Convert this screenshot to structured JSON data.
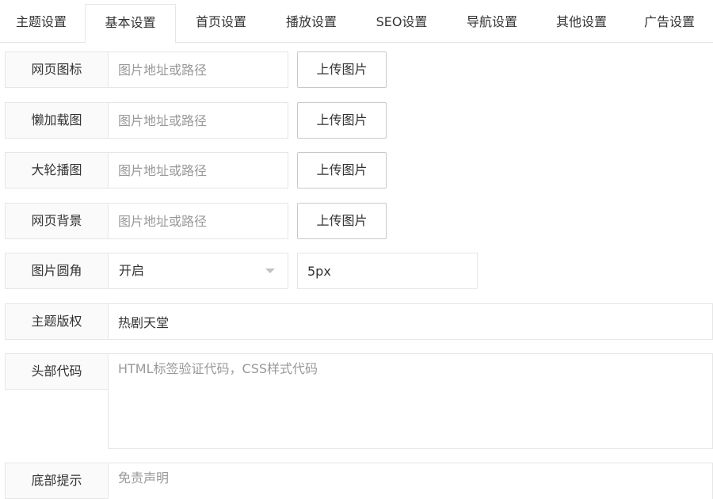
{
  "tabs": [
    {
      "label": "主题设置"
    },
    {
      "label": "基本设置"
    },
    {
      "label": "首页设置"
    },
    {
      "label": "播放设置"
    },
    {
      "label": "SEO设置"
    },
    {
      "label": "导航设置"
    },
    {
      "label": "其他设置"
    },
    {
      "label": "广告设置"
    }
  ],
  "active_tab": "基本设置",
  "form": {
    "favicon": {
      "label": "网页图标",
      "placeholder": "图片地址或路径",
      "button": "上传图片"
    },
    "lazyload": {
      "label": "懒加载图",
      "placeholder": "图片地址或路径",
      "button": "上传图片"
    },
    "carousel": {
      "label": "大轮播图",
      "placeholder": "图片地址或路径",
      "button": "上传图片"
    },
    "background": {
      "label": "网页背景",
      "placeholder": "图片地址或路径",
      "button": "上传图片"
    },
    "image_radius": {
      "label": "图片圆角",
      "select_value": "开启",
      "radius_value": "5px"
    },
    "copyright": {
      "label": "主题版权",
      "value": "热剧天堂"
    },
    "head_code": {
      "label": "头部代码",
      "placeholder": "HTML标签验证代码，CSS样式代码"
    },
    "footer_notice": {
      "label": "底部提示",
      "placeholder": "免责声明"
    }
  }
}
